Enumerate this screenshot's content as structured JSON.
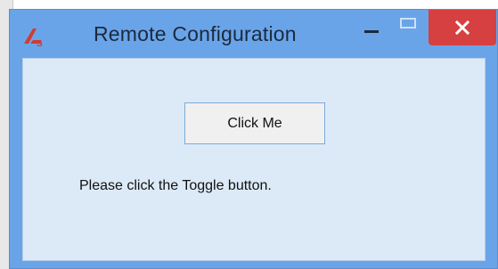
{
  "window": {
    "title": "Remote Configuration",
    "accent_color": "#6aa4e8",
    "close_color": "#d64040",
    "icons": {
      "app": "app-logo-icon",
      "minimize": "minimize-icon",
      "maximize": "maximize-icon",
      "close": "close-icon"
    }
  },
  "content": {
    "button_label": "Click Me",
    "instruction": "Please click the Toggle button."
  }
}
